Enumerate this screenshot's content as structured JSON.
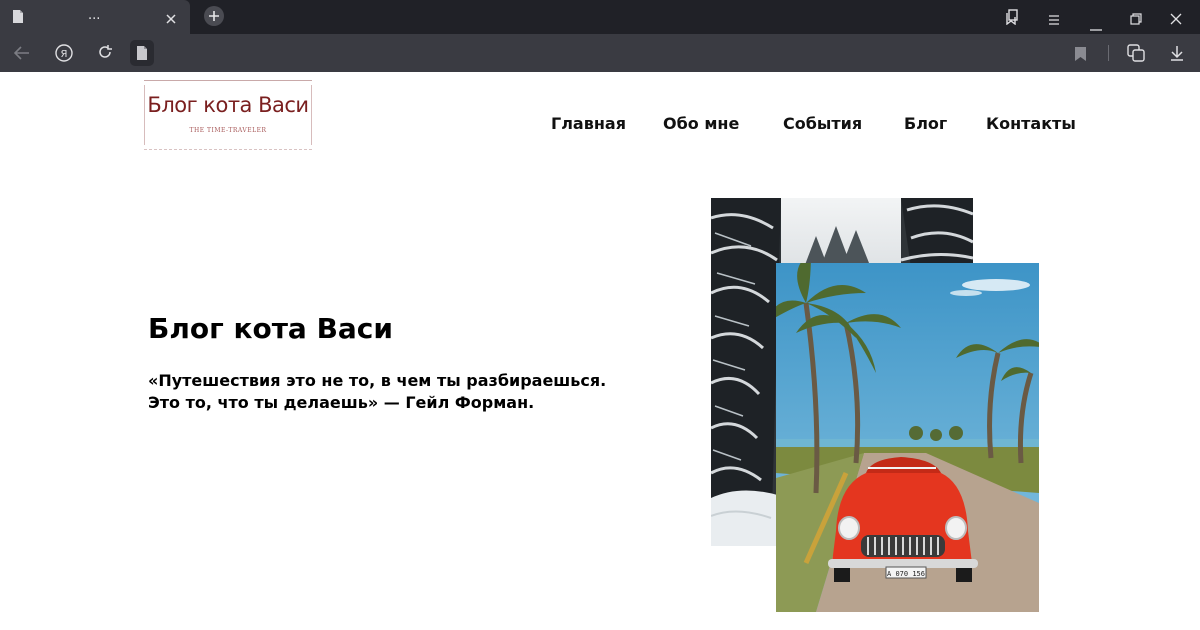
{
  "browser": {
    "tab_title": "...",
    "icons": [
      "page-icon",
      "close-icon",
      "plus-icon",
      "collections-icon",
      "menu-icon",
      "minimize-icon",
      "restore-icon",
      "close-icon",
      "back-icon",
      "yandex-icon",
      "reload-icon",
      "page-icon",
      "bookmark-icon",
      "screenshot-icon",
      "download-icon"
    ]
  },
  "site": {
    "logo": {
      "title": "Блог кота Васи",
      "subtitle": "THE TIME-TRAVELER"
    },
    "nav": [
      {
        "label": "Главная"
      },
      {
        "label": "Обо мне"
      },
      {
        "label": "События"
      },
      {
        "label": "Блог"
      },
      {
        "label": "Контакты"
      }
    ],
    "hero": {
      "title": "Блог кота Васи",
      "quote_line1": "«Путешествия это не то, в чем ты разбираешься.",
      "quote_line2": "Это то, что ты делаешь» — Гейл Форман."
    },
    "images": {
      "back_photo": "snowy-forest-photo",
      "front_photo": "red-car-palms-photo",
      "plate_text": "A 070 156"
    }
  },
  "colors": {
    "tabbar_bg": "#202127",
    "toolbar_bg": "#3a3b42",
    "logo_red": "#7a1f1f",
    "text": "#111111"
  }
}
